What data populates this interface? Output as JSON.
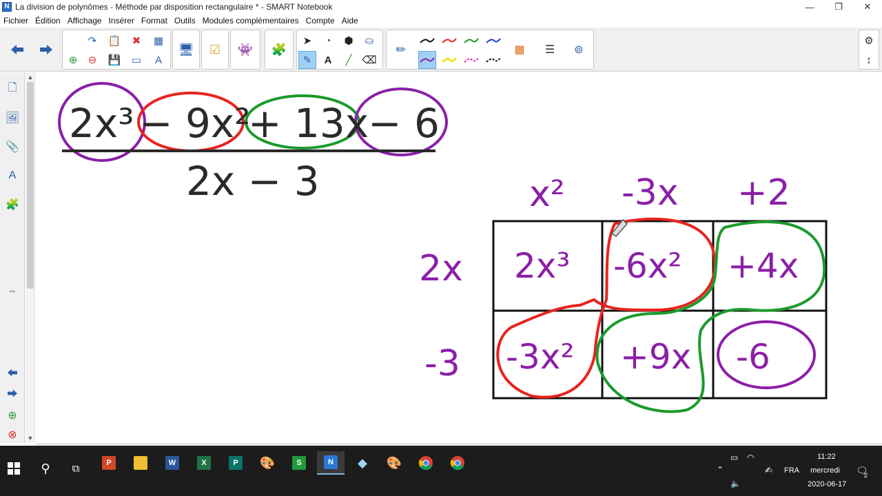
{
  "window": {
    "title": "La division de polynômes - Méthode par disposition rectangulaire * - SMART Notebook",
    "app_icon_letter": "N",
    "minimize": "—",
    "restore": "❐",
    "close": "✕"
  },
  "menu": [
    "Fichier",
    "Édition",
    "Affichage",
    "Insérer",
    "Format",
    "Outils",
    "Modules complémentaires",
    "Compte",
    "Aide"
  ],
  "sidebar_arrow": "⇔",
  "expression": {
    "numerator_terms": [
      "2x³",
      "− 9x²",
      "+ 13x",
      "− 6"
    ],
    "denominator": "2x − 3"
  },
  "grid": {
    "col_headers": [
      "x²",
      "-3x",
      "+2"
    ],
    "row_headers": [
      "2x",
      "-3"
    ],
    "cells": [
      [
        "2x³",
        "-6x²",
        "+4x"
      ],
      [
        "-3x²",
        "+9x",
        "-6"
      ]
    ]
  },
  "colors": {
    "purple": "#8b1fa8",
    "red": "#e8231f",
    "green": "#1b9a2b",
    "ink": "#2a2a2a",
    "toolbar_blue": "#2b5fa8"
  },
  "taskbar": {
    "time": "11:22",
    "day": "mercredi",
    "date": "2020-06-17",
    "lang": "FRA",
    "notification_count": "2"
  }
}
